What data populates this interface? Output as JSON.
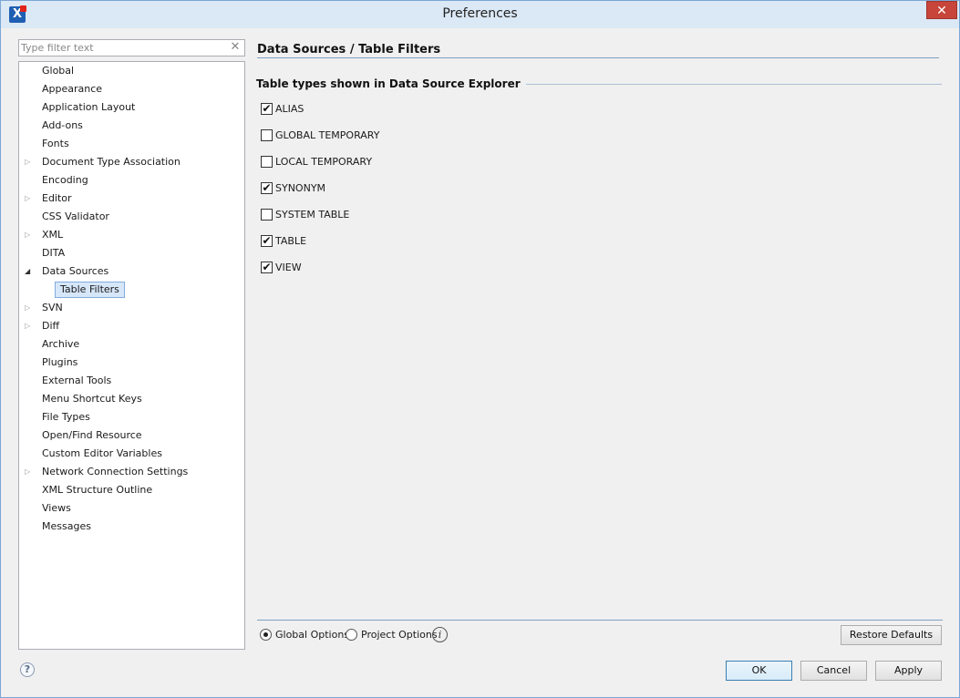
{
  "window": {
    "title": "Preferences",
    "app_icon_glyph": "X",
    "close_glyph": "✕"
  },
  "filter": {
    "placeholder": "Type filter text",
    "value": "",
    "clear_glyph": "✕"
  },
  "tree": {
    "items": [
      {
        "label": "Global",
        "expander": "none"
      },
      {
        "label": "Appearance",
        "expander": "none"
      },
      {
        "label": "Application Layout",
        "expander": "none"
      },
      {
        "label": "Add-ons",
        "expander": "none"
      },
      {
        "label": "Fonts",
        "expander": "none"
      },
      {
        "label": "Document Type Association",
        "expander": "collapsed"
      },
      {
        "label": "Encoding",
        "expander": "none"
      },
      {
        "label": "Editor",
        "expander": "collapsed"
      },
      {
        "label": "CSS Validator",
        "expander": "none"
      },
      {
        "label": "XML",
        "expander": "collapsed"
      },
      {
        "label": "DITA",
        "expander": "none"
      },
      {
        "label": "Data Sources",
        "expander": "expanded"
      },
      {
        "label": "Table Filters",
        "expander": "none",
        "child": true,
        "selected": true
      },
      {
        "label": "SVN",
        "expander": "collapsed"
      },
      {
        "label": "Diff",
        "expander": "collapsed"
      },
      {
        "label": "Archive",
        "expander": "none"
      },
      {
        "label": "Plugins",
        "expander": "none"
      },
      {
        "label": "External Tools",
        "expander": "none"
      },
      {
        "label": "Menu Shortcut Keys",
        "expander": "none"
      },
      {
        "label": "File Types",
        "expander": "none"
      },
      {
        "label": "Open/Find Resource",
        "expander": "none"
      },
      {
        "label": "Custom Editor Variables",
        "expander": "none"
      },
      {
        "label": "Network Connection Settings",
        "expander": "collapsed"
      },
      {
        "label": "XML Structure Outline",
        "expander": "none"
      },
      {
        "label": "Views",
        "expander": "none"
      },
      {
        "label": "Messages",
        "expander": "none"
      }
    ],
    "glyphs": {
      "collapsed": "▷",
      "expanded": "◢"
    }
  },
  "page": {
    "title": "Data Sources / Table Filters",
    "group_title": "Table types shown in Data Source Explorer",
    "check_glyph": "✔",
    "table_types": [
      {
        "label": "ALIAS",
        "checked": true
      },
      {
        "label": "GLOBAL TEMPORARY",
        "checked": false
      },
      {
        "label": "LOCAL TEMPORARY",
        "checked": false
      },
      {
        "label": "SYNONYM",
        "checked": true
      },
      {
        "label": "SYSTEM TABLE",
        "checked": false
      },
      {
        "label": "TABLE",
        "checked": true
      },
      {
        "label": "VIEW",
        "checked": true
      }
    ]
  },
  "options": {
    "global_label": "Global Options",
    "project_label": "Project Options",
    "selected": "global",
    "info_glyph": "i",
    "restore_label": "Restore Defaults"
  },
  "footer": {
    "help_glyph": "?",
    "ok_label": "OK",
    "cancel_label": "Cancel",
    "apply_label": "Apply"
  },
  "colors": {
    "selection_bg": "#d7e7fa",
    "selection_border": "#84acdd",
    "accent_rule": "#7f9fc4"
  }
}
